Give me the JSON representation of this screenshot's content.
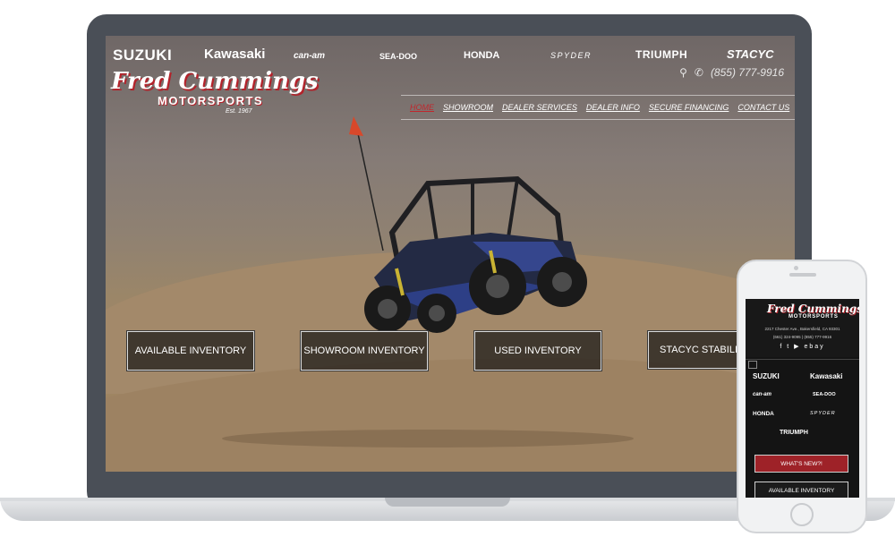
{
  "brands": {
    "suzuki": "SUZUKI",
    "kawasaki": "Kawasaki",
    "canam": "can-am",
    "seadoo": "SEA-DOO",
    "honda": "HONDA",
    "spyder": "SPYDER",
    "triumph": "TRIUMPH",
    "stacyc": "STACYC"
  },
  "logo": {
    "script": "Fred Cummings",
    "sub": "MOTORSPORTS",
    "est": "Est. 1967"
  },
  "contact": {
    "location_icon": "map-pin-icon",
    "phone_icon": "phone-icon",
    "phone": "(855) 777-9916"
  },
  "nav": {
    "home": "HOME",
    "showroom": "SHOWROOM",
    "dealer_services": "DEALER SERVICES",
    "dealer_info": "DEALER INFO",
    "secure_financing": "SECURE FINANCING",
    "contact_us": "CONTACT US"
  },
  "hero_buttons": {
    "available": "AVAILABLE INVENTORY",
    "showroom": "SHOWROOM INVENTORY",
    "used": "USED INVENTORY",
    "stacyc": "STACYC STABILITY"
  },
  "mobile": {
    "logo_script": "Fred Cummings",
    "logo_sub": "MOTORSPORTS",
    "address": "2217 Chester Ave., Bakersfield, CA 93301",
    "phones": "(661) 324-9095  |  (855) 777-9916",
    "social": "f  t  ▶  ebay",
    "brands": {
      "suzuki": "SUZUKI",
      "kawasaki": "Kawasaki",
      "canam": "can-am",
      "seadoo": "SEA-DOO",
      "honda": "HONDA",
      "spyder": "SPYDER",
      "triumph": "TRIUMPH"
    },
    "whats_new": "WHAT'S NEW?!",
    "available": "AVAILABLE INVENTORY"
  },
  "colors": {
    "accent_red": "#c0272d",
    "laptop_bezel": "#4a4f57"
  }
}
